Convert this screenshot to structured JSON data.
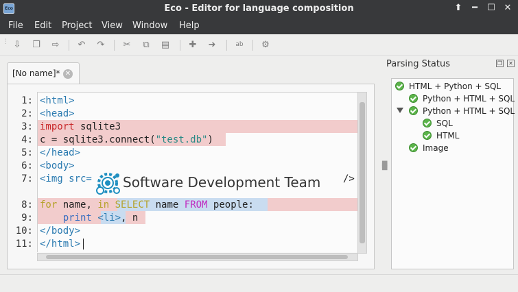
{
  "window": {
    "title": "Eco - Editor for language composition",
    "app_icon_label": "Eco",
    "buttons": [
      "⬆",
      "━",
      "☐",
      "✕"
    ]
  },
  "menu": [
    "File",
    "Edit",
    "Project",
    "View",
    "Window",
    "Help"
  ],
  "toolbar_icons": [
    "import-icon",
    "copy-file-icon",
    "export-icon",
    "undo-icon",
    "redo-icon",
    "cut-icon",
    "copy-icon",
    "paste-icon",
    "add-icon",
    "arrow-right-icon",
    "spellcheck-icon",
    "settings-icon"
  ],
  "editor": {
    "tab_label": "[No name]*",
    "line_numbers": [
      "1:",
      "2:",
      "3:",
      "4:",
      "5:",
      "6:",
      "7:",
      "8:",
      "9:",
      "10:",
      "11:"
    ],
    "lines": {
      "l1": "<html>",
      "l2": "<head>",
      "l3_kw": "import",
      "l3_rest": " sqlite3",
      "l4_a": "c = sqlite3.connect(",
      "l4_str": "\"test.db\"",
      "l4_b": ")",
      "l5": "</head>",
      "l6": "<body>",
      "l7_a": "<img src=",
      "l7_b": "/>",
      "l8_for": "for",
      "l8_name": " name, ",
      "l8_in": "in",
      "l8_select": "SELECT",
      "l8_name2": " name ",
      "l8_from": "FROM",
      "l8_rest": " people:",
      "l9_print": "print",
      "l9_li": "<li>",
      "l9_rest": ", n",
      "l10": "</body>",
      "l11": "</html>"
    },
    "logo_text": "Software Development Team"
  },
  "panel": {
    "title": "Parsing Status",
    "items": [
      {
        "label": "HTML + Python + SQL"
      },
      {
        "label": "Python + HTML + SQL"
      },
      {
        "label": "Python + HTML + SQL"
      },
      {
        "label": "SQL"
      },
      {
        "label": "HTML"
      },
      {
        "label": "Image"
      }
    ]
  },
  "colors": {
    "error_highlight": "#f2cccc",
    "embedded_highlight": "#c9dcf0",
    "ok_status": "#5bb44a"
  }
}
